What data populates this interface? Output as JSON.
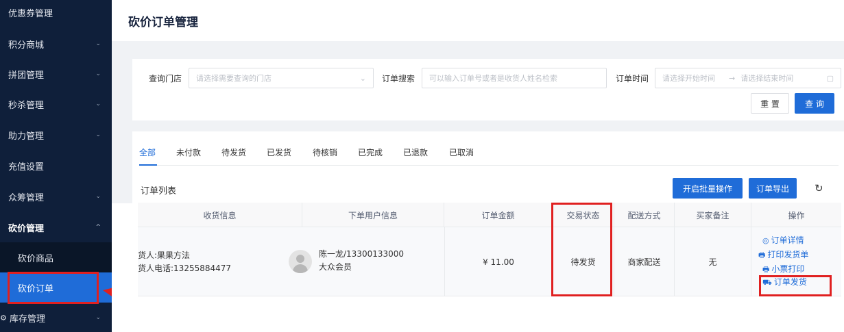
{
  "sidebar": {
    "items": [
      {
        "label": "优惠券管理",
        "chevron": ""
      },
      {
        "label": "积分商城",
        "chevron": "⌄"
      },
      {
        "label": "拼团管理",
        "chevron": "⌄"
      },
      {
        "label": "秒杀管理",
        "chevron": "⌄"
      },
      {
        "label": "助力管理",
        "chevron": "⌄"
      },
      {
        "label": "充值设置",
        "chevron": ""
      },
      {
        "label": "众筹管理",
        "chevron": "⌄"
      },
      {
        "label": "砍价管理",
        "chevron": "^"
      },
      {
        "label": "砍价商品",
        "chevron": ""
      },
      {
        "label": "砍价订单",
        "chevron": ""
      },
      {
        "label": "库存管理",
        "chevron": "⌄"
      }
    ]
  },
  "header": {
    "title": "砍价订单管理"
  },
  "filters": {
    "store_label": "查询门店",
    "store_placeholder": "请选择需要查询的门店",
    "search_label": "订单搜索",
    "search_placeholder": "可以输入订单号或者是收货人姓名检索",
    "time_label": "订单时间",
    "start_placeholder": "请选择开始时间",
    "arrow": "→",
    "end_placeholder": "请选择结束时间",
    "reset_label": "重 置",
    "query_label": "查 询"
  },
  "tabs": [
    "全部",
    "未付款",
    "待发货",
    "已发货",
    "待核销",
    "已完成",
    "已退款",
    "已取消"
  ],
  "list": {
    "title": "订单列表",
    "batch_label": "开启批量操作",
    "export_label": "订单导出",
    "refresh_icon": "↻"
  },
  "table": {
    "columns": [
      "收货信息",
      "下单用户信息",
      "订单金额",
      "交易状态",
      "配送方式",
      "买家备注",
      "操作"
    ],
    "rows": [
      {
        "receiver_name": "货人:果果方法",
        "receiver_phone": "货人电话:13255884477",
        "user": "陈一龙/13300133000",
        "member": "大众会员",
        "amount": "¥ 11.00",
        "status": "待发货",
        "delivery": "商家配送",
        "remark": "无",
        "ops": [
          "订单详情",
          "打印发货单",
          "小票打印",
          "订单发货"
        ]
      }
    ]
  },
  "colors": {
    "sidebar": "#0f1f3a",
    "accent": "#1f6cd8",
    "highlight": "#e02020"
  }
}
